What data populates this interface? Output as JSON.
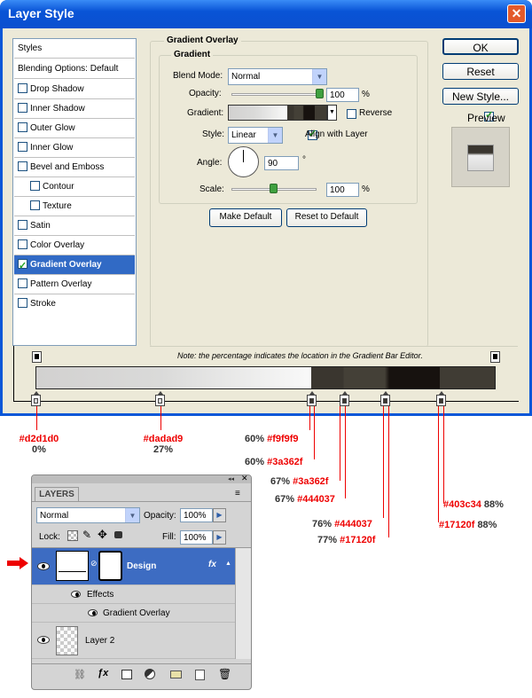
{
  "dialog": {
    "title": "Layer Style",
    "close": "✕"
  },
  "buttons": {
    "ok": "OK",
    "reset": "Reset",
    "new_style": "New Style...",
    "preview": "Preview",
    "make_default": "Make Default",
    "reset_default": "Reset to Default"
  },
  "styles": [
    "Styles",
    "Blending Options: Default",
    "Drop Shadow",
    "Inner Shadow",
    "Outer Glow",
    "Inner Glow",
    "Bevel and Emboss",
    "Contour",
    "Texture",
    "Satin",
    "Color Overlay",
    "Gradient Overlay",
    "Pattern Overlay",
    "Stroke"
  ],
  "panel": {
    "group": "Gradient Overlay",
    "sub": "Gradient",
    "blend_label": "Blend Mode:",
    "blend_value": "Normal",
    "opacity_label": "Opacity:",
    "opacity_value": "100",
    "pct": "%",
    "gradient_label": "Gradient:",
    "reverse": "Reverse",
    "style_label": "Style:",
    "style_value": "Linear",
    "align": "Align with Layer",
    "angle_label": "Angle:",
    "angle_value": "90",
    "deg": "°",
    "scale_label": "Scale:",
    "scale_value": "100",
    "opacity_level": 1.0,
    "scale_level": 0.5
  },
  "note": "Note: the percentage indicates the location in the Gradient Bar Editor.",
  "annotations": [
    {
      "pct": "0%",
      "hex": "#d2d1d0"
    },
    {
      "pct": "27%",
      "hex": "#dadad9"
    },
    {
      "pct": "60%",
      "hex": "#f9f9f9"
    },
    {
      "pct": "60%",
      "hex": "#3a362f"
    },
    {
      "pct": "67%",
      "hex": "#3a362f"
    },
    {
      "pct": "67%",
      "hex": "#444037"
    },
    {
      "pct": "76%",
      "hex": "#444037"
    },
    {
      "pct": "77%",
      "hex": "#17120f"
    },
    {
      "pct": "88%",
      "hex": "#403c34"
    },
    {
      "pct": "88%",
      "hex": "#17120f"
    }
  ],
  "layers": {
    "tab": "LAYERS",
    "mode": "Normal",
    "opacity_label": "Opacity:",
    "opacity": "100%",
    "lock_label": "Lock:",
    "fill_label": "Fill:",
    "fill": "100%",
    "layer1": "Design",
    "effects": "Effects",
    "effect1": "Gradient Overlay",
    "layer2": "Layer 2",
    "fx": "fx"
  }
}
